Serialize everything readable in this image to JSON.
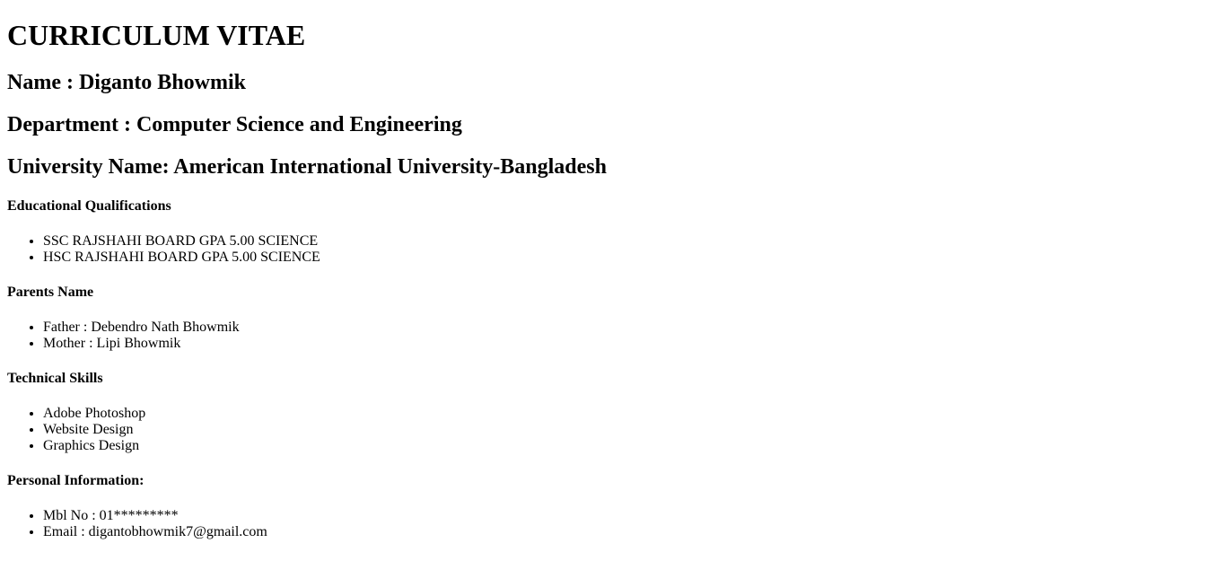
{
  "title": "CURRICULUM VITAE",
  "name_line": "Name : Diganto Bhowmik",
  "department_line": "Department : Computer Science and Engineering",
  "university_line": "University Name: American International University-Bangladesh",
  "sections": [
    {
      "heading": "Educational Qualifications",
      "items": [
        "SSC RAJSHAHI BOARD GPA 5.00 SCIENCE",
        "HSC RAJSHAHI BOARD GPA 5.00 SCIENCE"
      ]
    },
    {
      "heading": "Parents Name",
      "items": [
        "Father : Debendro Nath Bhowmik",
        "Mother : Lipi Bhowmik"
      ]
    },
    {
      "heading": "Technical Skills",
      "items": [
        "Adobe Photoshop",
        "Website Design",
        "Graphics Design"
      ]
    },
    {
      "heading": "Personal Information:",
      "items": [
        "Mbl No : 01*********",
        "Email : digantobhowmik7@gmail.com"
      ]
    }
  ]
}
